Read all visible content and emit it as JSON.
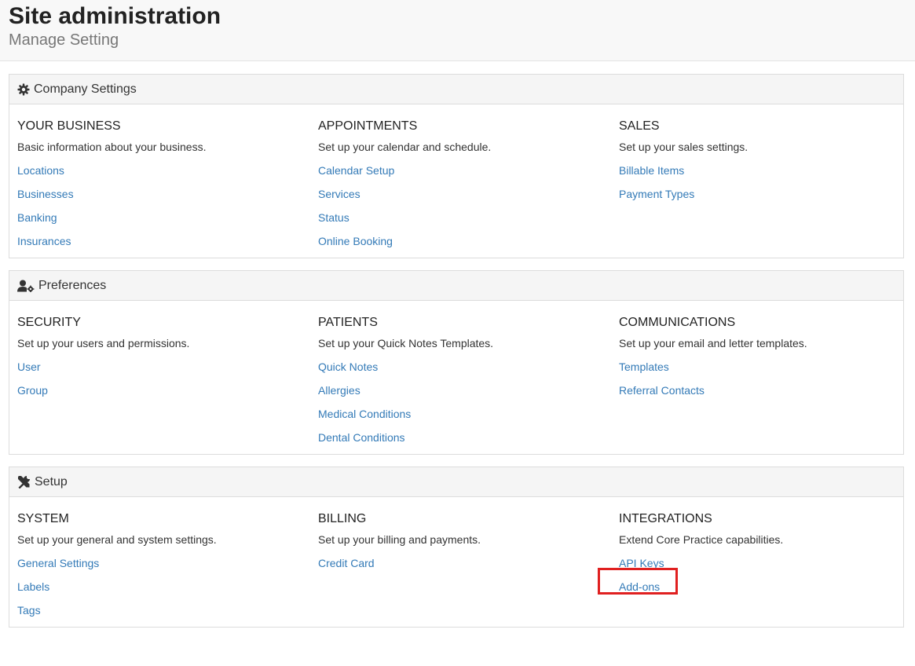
{
  "header": {
    "title": "Site administration",
    "subtitle": "Manage Setting"
  },
  "panels": [
    {
      "title": "Company Settings",
      "icon": "gear-icon",
      "columns": [
        {
          "title": "YOUR BUSINESS",
          "desc": "Basic information about your business.",
          "links": [
            "Locations",
            "Businesses",
            "Banking",
            "Insurances"
          ]
        },
        {
          "title": "APPOINTMENTS",
          "desc": "Set up your calendar and schedule.",
          "links": [
            "Calendar Setup",
            "Services",
            "Status",
            "Online Booking"
          ]
        },
        {
          "title": "SALES",
          "desc": "Set up your sales settings.",
          "links": [
            "Billable Items",
            "Payment Types"
          ]
        }
      ]
    },
    {
      "title": "Preferences",
      "icon": "user-gear-icon",
      "columns": [
        {
          "title": "SECURITY",
          "desc": "Set up your users and permissions.",
          "links": [
            "User",
            "Group"
          ]
        },
        {
          "title": "PATIENTS",
          "desc": "Set up your Quick Notes Templates.",
          "links": [
            "Quick Notes",
            "Allergies",
            "Medical Conditions",
            "Dental Conditions"
          ]
        },
        {
          "title": "COMMUNICATIONS",
          "desc": "Set up your email and letter templates.",
          "links": [
            "Templates",
            "Referral Contacts"
          ]
        }
      ]
    },
    {
      "title": "Setup",
      "icon": "tools-icon",
      "columns": [
        {
          "title": "SYSTEM",
          "desc": "Set up your general and system settings.",
          "links": [
            "General Settings",
            "Labels",
            "Tags"
          ]
        },
        {
          "title": "BILLING",
          "desc": "Set up your billing and payments.",
          "links": [
            "Credit Card"
          ]
        },
        {
          "title": "INTEGRATIONS",
          "desc": "Extend Core Practice capabilities.",
          "links": [
            "API Keys",
            "Add-ons"
          ]
        }
      ]
    }
  ],
  "colors": {
    "link": "#337ab7",
    "highlight": "#e02020"
  }
}
